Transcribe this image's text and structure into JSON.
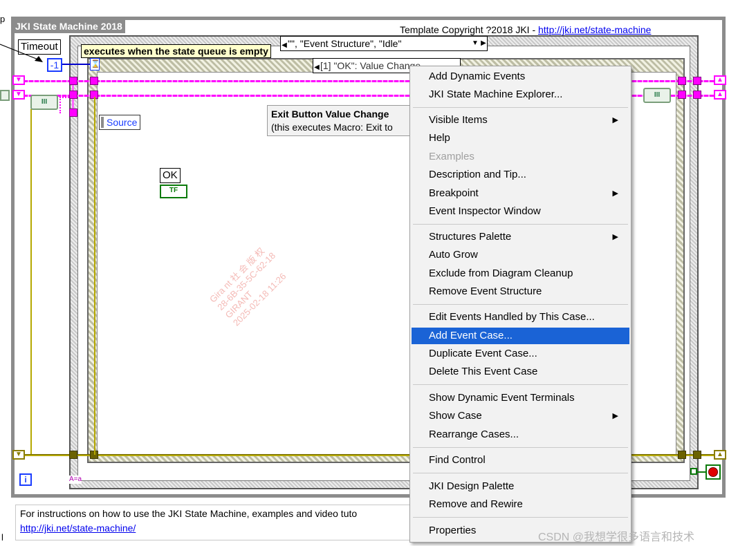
{
  "diagram": {
    "loop_title": "JKI State Machine 2018",
    "copyright_prefix": "Template Copyright ?2018 JKI - ",
    "copyright_link": "http://jki.net/state-machine",
    "timeout_label": "Timeout",
    "timeout_value": "-1",
    "comment": "executes when the state queue is empty",
    "case_selector": "\"\", \"Event Structure\", \"Idle\"",
    "event_selector": "[1] \"OK\": Value Change",
    "source_label": "Source",
    "ok_label": "OK",
    "ok_terminal": "TF",
    "event_description_title": "Exit Button Value Change",
    "event_description_body": "(this executes Macro: Exit to",
    "iteration_terminal": "i",
    "case_index": "A=a",
    "cluster_glyph": "III",
    "loop_edge_text_left": "p",
    "loop_edge_text_bottom": "l"
  },
  "footer_note": {
    "text": "For instructions on how to use the JKI State Machine, examples and video tuto",
    "link": "http://jki.net/state-machine/"
  },
  "context_menu": {
    "items": [
      {
        "label": "Add Dynamic Events"
      },
      {
        "label": "JKI State Machine Explorer..."
      },
      {
        "label": "Visible Items",
        "submenu": true
      },
      {
        "label": "Help"
      },
      {
        "label": "Examples",
        "disabled": true
      },
      {
        "label": "Description and Tip..."
      },
      {
        "label": "Breakpoint",
        "submenu": true
      },
      {
        "label": "Event Inspector Window"
      },
      {
        "label": "Structures Palette",
        "submenu": true
      },
      {
        "label": "Auto Grow"
      },
      {
        "label": "Exclude from Diagram Cleanup"
      },
      {
        "label": "Remove Event Structure"
      },
      {
        "label": "Edit Events Handled by This Case..."
      },
      {
        "label": "Add Event Case...",
        "highlighted": true
      },
      {
        "label": "Duplicate Event Case..."
      },
      {
        "label": "Delete This Event Case"
      },
      {
        "label": "Show Dynamic Event Terminals"
      },
      {
        "label": "Show Case",
        "submenu": true
      },
      {
        "label": "Rearrange Cases..."
      },
      {
        "label": "Find Control"
      },
      {
        "label": "JKI Design Palette"
      },
      {
        "label": "Remove and Rewire"
      },
      {
        "label": "Properties"
      }
    ],
    "highlight_color": "#1a63d6"
  },
  "watermark": {
    "line1": "Gira nt 社 会 版 权",
    "line2": "28-6B-35-5C-62-18",
    "line3": "GIRANT",
    "line4": "2025-02-18 11:26"
  },
  "csdn_watermark": "CSDN @我想学很多语言和技术",
  "colors": {
    "wire_state": "#ff00ff",
    "wire_error": "#b5a800",
    "wire_boolean": "#0a7a0a",
    "loop_border": "#8c8c8c"
  }
}
